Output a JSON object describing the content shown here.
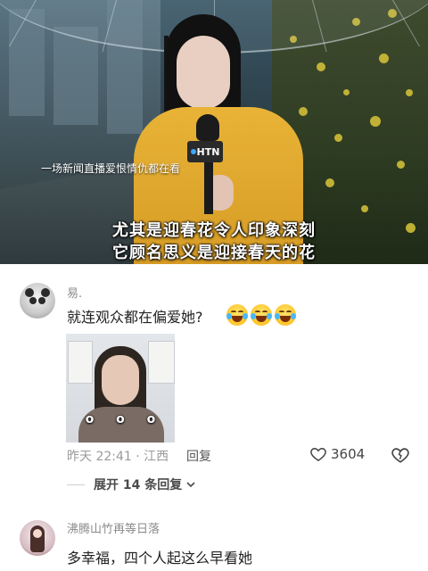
{
  "video": {
    "overlay_caption": "一场新闻直播爱恨情仇都在看",
    "subtitle_line1": "尤其是迎春花令人印象深刻",
    "subtitle_line2": "它顾名思义是迎接春天的花",
    "mic_logo": "HTN"
  },
  "comments": [
    {
      "username": "易.",
      "text": "就连观众都在偏爱她?",
      "emojis": [
        "laugh-cry-emoji",
        "laugh-cry-emoji",
        "laugh-cry-emoji"
      ],
      "image_caption_overlay": "o o o",
      "time_location": "昨天 22:41 · 江西",
      "reply_label": "回复",
      "like_count": "3604",
      "expand_replies_label": "展开 14 条回复"
    },
    {
      "username": "沸腾山竹再等日落",
      "text": "多幸福，四个人起这么早看她"
    }
  ],
  "colors": {
    "username": "#8a8a8a",
    "comment_text": "#222222",
    "meta": "#9a9a9a",
    "coat": "#e8b337"
  }
}
